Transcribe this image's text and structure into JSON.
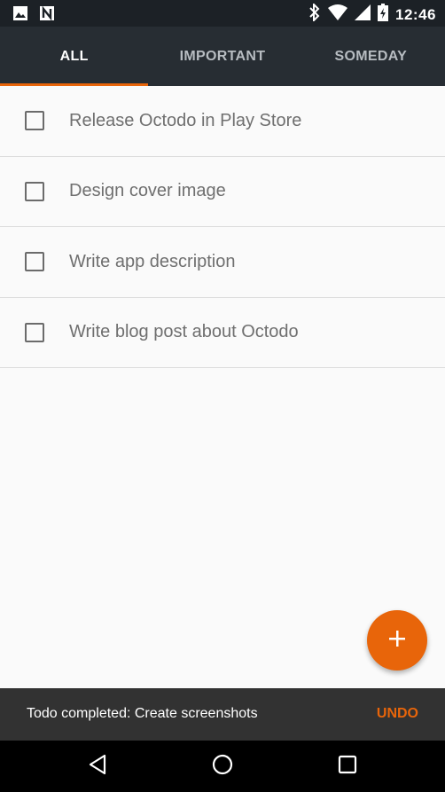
{
  "status_bar": {
    "time": "12:46",
    "left_icons": [
      "image-icon",
      "n-notification-icon"
    ],
    "right_icons": [
      "bluetooth-icon",
      "wifi-icon",
      "signal-icon",
      "battery-icon"
    ]
  },
  "tabs": [
    {
      "label": "ALL",
      "active": true
    },
    {
      "label": "IMPORTANT",
      "active": false
    },
    {
      "label": "SOMEDAY",
      "active": false
    }
  ],
  "todos": [
    {
      "label": "Release Octodo in Play Store",
      "checked": false
    },
    {
      "label": "Design cover image",
      "checked": false
    },
    {
      "label": "Write app description",
      "checked": false
    },
    {
      "label": "Write blog post about Octodo",
      "checked": false
    }
  ],
  "fab": {
    "icon": "plus-icon"
  },
  "snackbar": {
    "message": "Todo completed: Create screenshots",
    "action": "UNDO"
  },
  "nav_bar": {
    "icons": [
      "back-icon",
      "home-icon",
      "recents-icon"
    ]
  },
  "colors": {
    "accent": "#e8650a",
    "tab_bar": "#272d33",
    "status_bar": "#1c2126",
    "snackbar": "#323232"
  }
}
